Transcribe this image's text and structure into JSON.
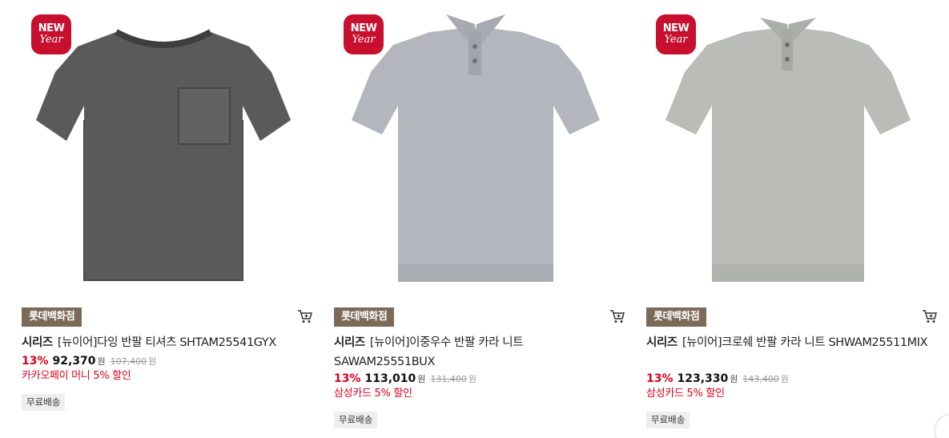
{
  "products": [
    {
      "badge": {
        "line1": "NEW",
        "line2": "Year"
      },
      "store": "롯데백화점",
      "brand": "시리즈",
      "name": "[뉴이어]다잉 반팔 티셔츠 SHTAM25541GYX",
      "discount_rate": "13%",
      "price": "92,370",
      "currency": "원",
      "original_price": "107,400",
      "promo": "카카오페이 머니 5% 할인",
      "shipping": "무료배송",
      "image_icon": "gray-pocket-tshirt",
      "shirt_color": "#5a5a5a"
    },
    {
      "badge": {
        "line1": "NEW",
        "line2": "Year"
      },
      "store": "롯데백화점",
      "brand": "시리즈",
      "name": "[뉴이어]이중우수 반팔 카라 니트 SAWAM25551BUX",
      "discount_rate": "13%",
      "price": "113,010",
      "currency": "원",
      "original_price": "131,400",
      "promo": "삼성카드 5% 할인",
      "shipping": "무료배송",
      "image_icon": "light-blue-gray-polo-knit",
      "shirt_color": "#b3b7bd"
    },
    {
      "badge": {
        "line1": "NEW",
        "line2": "Year"
      },
      "store": "롯데백화점",
      "brand": "시리즈",
      "name": "[뉴이어]크로쉐 반팔 카라 니트 SHWAM25511MIX",
      "discount_rate": "13%",
      "price": "123,330",
      "currency": "원",
      "original_price": "143,400",
      "promo": "삼성카드 5% 할인",
      "shipping": "무료배송",
      "image_icon": "sage-gray-polo-knit",
      "shirt_color": "#b9bcb7"
    }
  ],
  "colors": {
    "badge_red": "#c8102e",
    "store_tag": "#7b6a58",
    "discount_red": "#e0001b"
  }
}
